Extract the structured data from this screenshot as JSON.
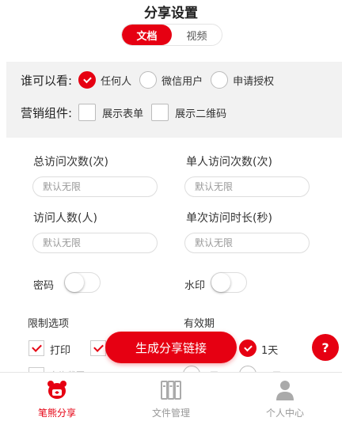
{
  "page": {
    "title": "分享设置"
  },
  "segment": {
    "items": [
      "文档",
      "视频"
    ],
    "active": "文档"
  },
  "visibility": {
    "label": "谁可以看:",
    "options": [
      {
        "label": "任何人",
        "selected": true
      },
      {
        "label": "微信用户",
        "selected": false
      },
      {
        "label": "申请授权",
        "selected": false
      }
    ]
  },
  "marketing": {
    "label": "营销组件:",
    "options": [
      {
        "label": "展示表单",
        "checked": false
      },
      {
        "label": "展示二维码",
        "checked": false
      }
    ]
  },
  "fields": [
    {
      "label": "总访问次数(次)",
      "placeholder": "默认无限"
    },
    {
      "label": "单人访问次数(次)",
      "placeholder": "默认无限"
    },
    {
      "label": "访问人数(人)",
      "placeholder": "默认无限"
    },
    {
      "label": "单次访问时长(秒)",
      "placeholder": "默认无限"
    }
  ],
  "toggles": [
    {
      "label": "密码",
      "on": false
    },
    {
      "label": "水印",
      "on": false
    }
  ],
  "restrict": {
    "label": "限制选项",
    "options": [
      {
        "label": "打印",
        "checked": true
      },
      {
        "label": "",
        "checked": true
      },
      {
        "label": "允许截图",
        "checked": false
      }
    ]
  },
  "validity": {
    "label": "有效期",
    "options": [
      {
        "label": "1天",
        "selected": true
      },
      {
        "label": "7天",
        "selected": false
      },
      {
        "label": "30天",
        "selected": false
      }
    ]
  },
  "buttons": {
    "generate": "生成分享链接",
    "help": "?"
  },
  "tabbar": {
    "items": [
      {
        "label": "笔熊分享",
        "active": true
      },
      {
        "label": "文件管理",
        "active": false
      },
      {
        "label": "个人中心",
        "active": false
      }
    ]
  },
  "colors": {
    "accent": "#e60012",
    "panel": "#f2f2f2",
    "inactive": "#999999"
  }
}
